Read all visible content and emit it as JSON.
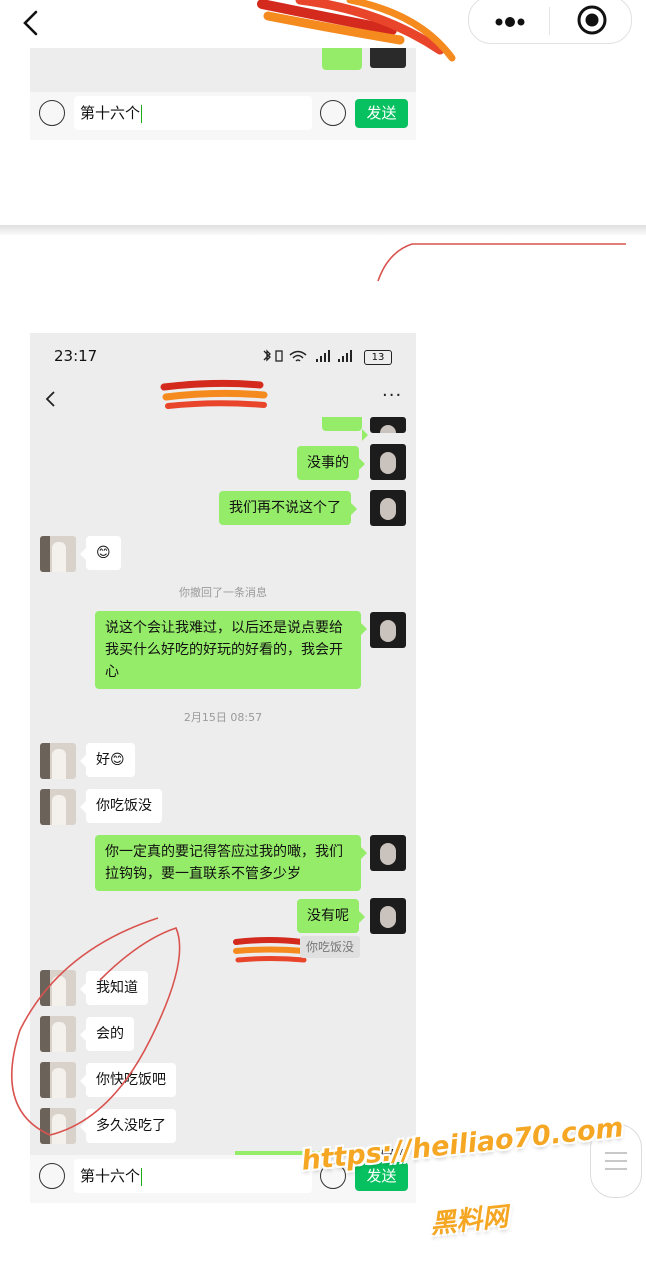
{
  "icons": {
    "back": "chevron-left-icon",
    "more": "more-dots-icon",
    "close": "target-circle-icon",
    "voice": "voice-icon",
    "emoji": "emoji-icon"
  },
  "colors": {
    "chat_bg": "#ededed",
    "bubble_me": "#95ec69",
    "bubble_them": "#ffffff",
    "send_button": "#07c160",
    "redaction": "#e8452a",
    "annotation": "#d9534f",
    "watermark": "#f5a623"
  },
  "top_screenshot": {
    "input_value": "第十六个",
    "send_label": "发送"
  },
  "chat": {
    "status_time": "23:17",
    "battery_level": "13",
    "nav_more": "···",
    "messages": [
      {
        "side": "me",
        "text": "没事的"
      },
      {
        "side": "me",
        "text": "我们再不说这个了"
      },
      {
        "side": "them",
        "text": "😊"
      },
      {
        "side": "system",
        "text": "你撤回了一条消息"
      },
      {
        "side": "me",
        "text": "说这个会让我难过，以后还是说点要给我买什么好吃的好玩的好看的，我会开心"
      },
      {
        "side": "system",
        "text": "2月15日 08:57"
      },
      {
        "side": "them",
        "text": "好😊"
      },
      {
        "side": "them",
        "text": "你吃饭没"
      },
      {
        "side": "me",
        "text": "你一定真的要记得答应过我的噉，我们拉钩钩，要一直联系不管多少岁"
      },
      {
        "side": "me",
        "text": "没有呢"
      },
      {
        "side": "quote",
        "text": "你吃饭没"
      },
      {
        "side": "them",
        "text": "我知道"
      },
      {
        "side": "them",
        "text": "会的"
      },
      {
        "side": "them",
        "text": "你快吃饭吧"
      },
      {
        "side": "them",
        "text": "多久没吃了"
      }
    ],
    "input_value": "第十六个",
    "send_label": "发送"
  },
  "watermark": {
    "url": "https://heiliao70.com",
    "name": "黑料网"
  }
}
